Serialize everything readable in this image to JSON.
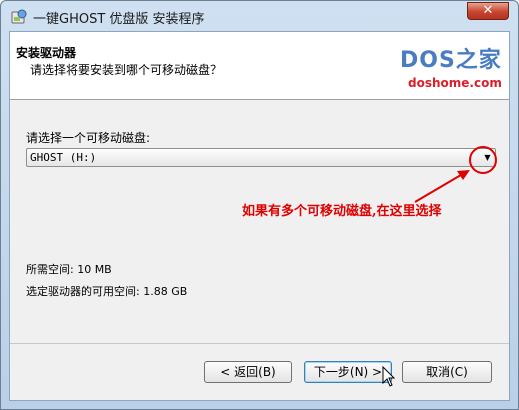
{
  "window": {
    "title": "一键GHOST 优盘版 安装程序",
    "close_symbol": "✕"
  },
  "header": {
    "title": "安装驱动器",
    "subtitle": "请选择将要安装到哪个可移动磁盘？",
    "logo_main": "DOS之家",
    "logo_sub": "doshome.com"
  },
  "drive_select": {
    "label": "请选择一个可移动磁盘:",
    "selected": "GHOST (H:)"
  },
  "annotation": {
    "text": "如果有多个可移动磁盘,在这里选择",
    "color": "#e00000"
  },
  "info": {
    "required_space": "所需空间: 10 MB",
    "available_space": "选定驱动器的可用空间: 1.88 GB"
  },
  "buttons": {
    "back": "< 返回(B)",
    "next": "下一步(N) >",
    "cancel": "取消(C)"
  }
}
